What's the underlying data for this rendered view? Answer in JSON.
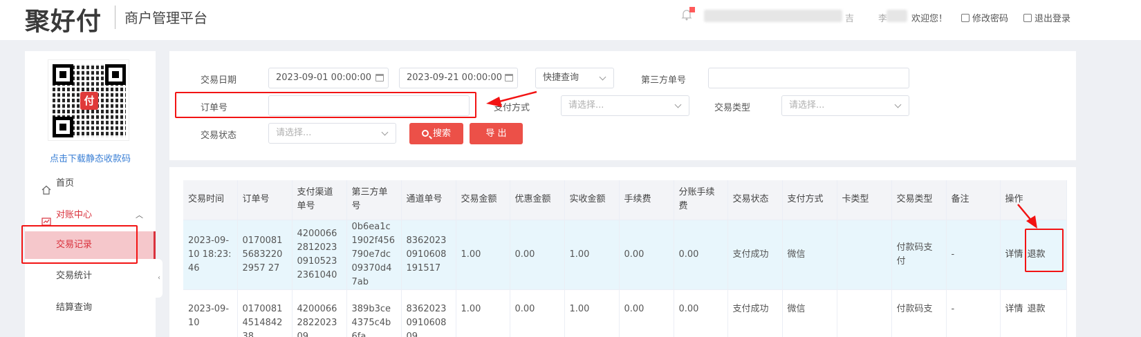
{
  "header": {
    "logo_text": "聚好付",
    "platform_title": "商户管理平台",
    "welcome": "欢迎您！",
    "change_password": "修改密码",
    "logout": "退出登录",
    "blurred_char_1": "吉",
    "blurred_char_2": "李"
  },
  "sidebar": {
    "qr_logo_char": "付",
    "download_link": "点击下载静态收款码",
    "items": [
      {
        "label": "首页"
      },
      {
        "label": "对账中心"
      },
      {
        "label": "交易记录"
      },
      {
        "label": "交易统计"
      },
      {
        "label": "结算查询"
      }
    ]
  },
  "filter": {
    "trade_date_label": "交易日期",
    "start_date": "2023-09-01 00:00:00",
    "end_date": "2023-09-21 00:00:00",
    "quick_query": "快捷查询",
    "third_party_no_label": "第三方单号",
    "third_party_no_value": "",
    "order_no_label": "订单号",
    "order_no_value": "",
    "pay_method_label": "支付方式",
    "pay_method_placeholder": "请选择...",
    "trade_type_label": "交易类型",
    "trade_type_placeholder": "请选择...",
    "trade_status_label": "交易状态",
    "trade_status_placeholder": "请选择...",
    "search_button": "搜索",
    "export_button": "导 出"
  },
  "table": {
    "columns": [
      "交易时间",
      "订单号",
      "支付渠道单号",
      "第三方单号",
      "通道单号",
      "交易金额",
      "优惠金额",
      "实收金额",
      "手续费",
      "分账手续费",
      "交易状态",
      "支付方式",
      "卡类型",
      "交易类型",
      "备注",
      "操作"
    ],
    "rows": [
      {
        "time": "2023-09-10 18:23:46",
        "order_no": "017008156832202957 27",
        "channel_no": "4200066281202309105232361040",
        "third_party_no": "0b6ea1c1902f456790e7dc09370d47ab",
        "passage_no": "83620230910608191517",
        "amount": "1.00",
        "discount": "0.00",
        "received": "1.00",
        "fee": "0.00",
        "split_fee": "0.00",
        "status": "支付成功",
        "pay_method": "微信",
        "card_type": "",
        "trade_type": "付款码支付",
        "remark": "-",
        "op_detail": "详情",
        "op_refund": "退款"
      },
      {
        "time": "2023-09-10",
        "order_no": "0170081451484238",
        "channel_no": "4200066282202309",
        "third_party_no": "389b3ce4375c4b6fa",
        "passage_no": "8362023091060809",
        "amount": "1.00",
        "discount": "0.00",
        "received": "1.00",
        "fee": "0.00",
        "split_fee": "0.00",
        "status": "支付成功",
        "pay_method": "微信",
        "card_type": "",
        "trade_type": "付款码支",
        "remark": "-",
        "op_detail": "详情",
        "op_refund": "退款"
      }
    ]
  },
  "colors": {
    "accent": "#d9313c",
    "button": "#ec5048",
    "annotation": "#f21313",
    "link": "#3a7fd5"
  }
}
